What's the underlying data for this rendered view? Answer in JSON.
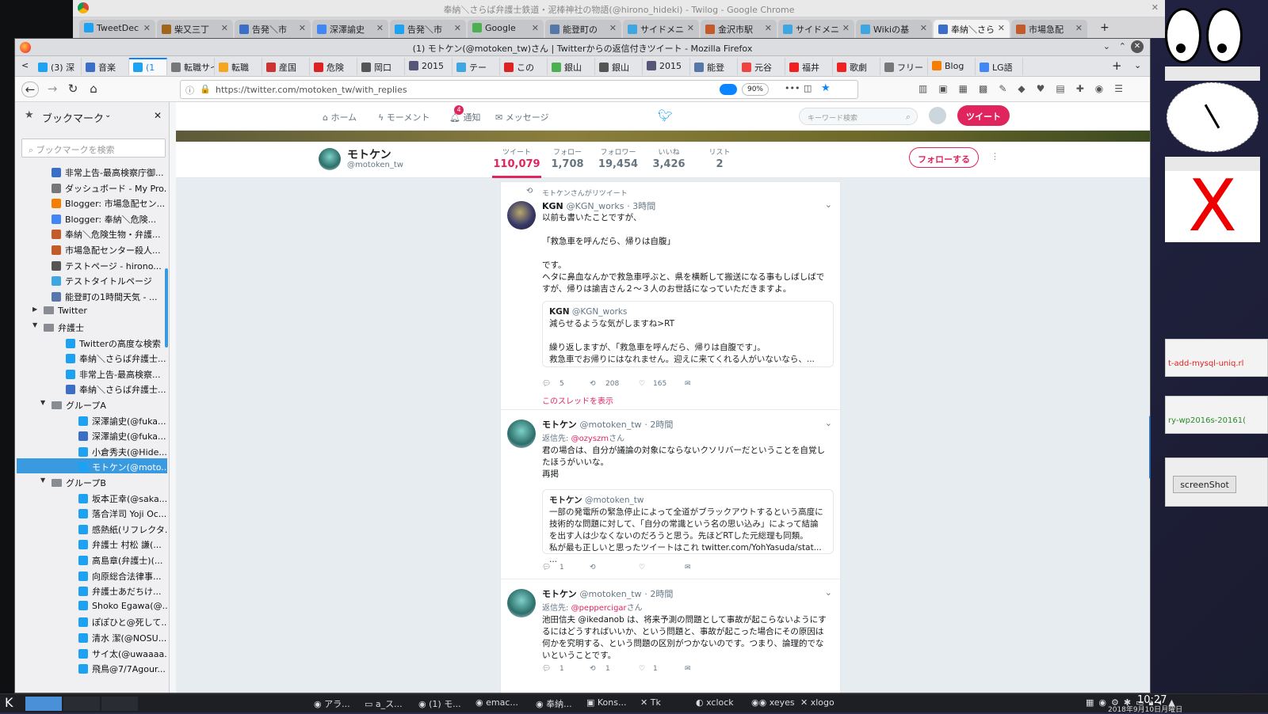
{
  "chrome": {
    "title": "奉納＼さらば弁護士鉄道・泥棒神社の物語(@hirono_hideki) - Twilog - Google Chrome",
    "tabs": [
      "TweetDec",
      "柴又三丁",
      "告発＼市",
      "深澤諭史",
      "告発＼市",
      "Google",
      "能登町の",
      "サイドメニ",
      "金沢市駅",
      "サイドメニ",
      "Wikiの基",
      "奉納＼さら",
      "市場急配"
    ]
  },
  "firefox": {
    "title": "(1) モトケン(@motoken_tw)さん | Twitterからの返信付きツイート - Mozilla Firefox",
    "tabs": [
      "(3) 深",
      "音楽",
      "(1",
      "転職サイ",
      "転職",
      "産国",
      "危険",
      "岡口",
      "2015",
      "テー",
      "この",
      "銀山",
      "銀山",
      "2015",
      "能登",
      "元谷",
      "福井",
      "歌劇",
      "フリー",
      "Blog",
      "LG語"
    ],
    "url": "https://twitter.com/motoken_tw/with_replies",
    "zoom": "90%"
  },
  "sidebar": {
    "title": "ブックマーク",
    "search_placeholder": "ブックマークを検索",
    "items": [
      {
        "label": "非常上告-最高検察庁御...",
        "c": "#3b6ec7",
        "lvl": 2
      },
      {
        "label": "ダッシュボード - My Pro...",
        "c": "#777",
        "lvl": 2
      },
      {
        "label": "Blogger: 市場急配セン...",
        "c": "#f57d00",
        "lvl": 2
      },
      {
        "label": "Blogger: 奉納＼危険...",
        "c": "#4285f4",
        "lvl": 2
      },
      {
        "label": "奉納＼危険生物・弁護...",
        "c": "#c35a2a",
        "lvl": 2
      },
      {
        "label": "市場急配センター殺人...",
        "c": "#c35a2a",
        "lvl": 2
      },
      {
        "label": "テストページ - hirono...",
        "c": "#555",
        "lvl": 2
      },
      {
        "label": "テストタイトルページ",
        "c": "#3ea6e0",
        "lvl": 2
      },
      {
        "label": "能登町の1時間天気 - ...",
        "c": "#5577aa",
        "lvl": 2
      },
      {
        "label": "Twitter",
        "c": "folder",
        "lvl": 1,
        "arrow": "▶"
      },
      {
        "label": "弁護士",
        "c": "folder",
        "lvl": 1,
        "arrow": "▼"
      },
      {
        "label": "Twitterの高度な検索",
        "c": "#1da1f2",
        "lvl": 3
      },
      {
        "label": "奉納＼さらば弁護士...",
        "c": "#1da1f2",
        "lvl": 3
      },
      {
        "label": "非常上告-最高検察...",
        "c": "#1da1f2",
        "lvl": 3
      },
      {
        "label": "奉納＼さらば弁護士...",
        "c": "#3b6ec7",
        "lvl": 3
      },
      {
        "label": "グループA",
        "c": "folder",
        "lvl": 2,
        "arrow": "▼"
      },
      {
        "label": "深澤諭史(@fuka...",
        "c": "#1da1f2",
        "lvl": 4
      },
      {
        "label": "深澤諭史(@fuka...",
        "c": "#3b6ec7",
        "lvl": 4
      },
      {
        "label": "小倉秀夫(@Hide...",
        "c": "#1da1f2",
        "lvl": 4
      },
      {
        "label": "モトケン(@moto...",
        "c": "#1da1f2",
        "lvl": 4,
        "sel": true
      },
      {
        "label": "グループB",
        "c": "folder",
        "lvl": 2,
        "arrow": "▼"
      },
      {
        "label": "坂本正幸(@saka...",
        "c": "#1da1f2",
        "lvl": 4
      },
      {
        "label": "落合洋司 Yoji Oc...",
        "c": "#1da1f2",
        "lvl": 4
      },
      {
        "label": "感熱紙(リフレクタ...",
        "c": "#1da1f2",
        "lvl": 4
      },
      {
        "label": "弁護士 村松 謙(...",
        "c": "#1da1f2",
        "lvl": 4
      },
      {
        "label": "高島章(弁護士)(...",
        "c": "#1da1f2",
        "lvl": 4
      },
      {
        "label": "向原総合法律事...",
        "c": "#1da1f2",
        "lvl": 4
      },
      {
        "label": "弁護士あだちけ...",
        "c": "#1da1f2",
        "lvl": 4
      },
      {
        "label": "Shoko Egawa(@...",
        "c": "#1da1f2",
        "lvl": 4
      },
      {
        "label": "ぽぽひと@死して...",
        "c": "#1da1f2",
        "lvl": 4
      },
      {
        "label": "清水 潔(@NOSU...",
        "c": "#1da1f2",
        "lvl": 4
      },
      {
        "label": "サイ太(@uwaaaa...",
        "c": "#1da1f2",
        "lvl": 4
      },
      {
        "label": "飛鳥@7/7Agour...",
        "c": "#1da1f2",
        "lvl": 4
      }
    ]
  },
  "twitter": {
    "nav": {
      "home": "ホーム",
      "moments": "モーメント",
      "notifications": "通知",
      "notif_count": "4",
      "messages": "メッセージ",
      "search_placeholder": "キーワード検索",
      "tweet_btn": "ツイート"
    },
    "profile": {
      "name": "モトケン",
      "handle": "@motoken_tw",
      "follow_btn": "フォローする",
      "stats": [
        {
          "label": "ツイート",
          "value": "110,079"
        },
        {
          "label": "フォロー",
          "value": "1,708"
        },
        {
          "label": "フォロワー",
          "value": "19,454"
        },
        {
          "label": "いいね",
          "value": "3,426"
        },
        {
          "label": "リスト",
          "value": "2"
        }
      ]
    },
    "tweets": [
      {
        "retweet_note": "モトケンさんがリツイート",
        "name": "KGN",
        "handle": "@KGN_works",
        "time": "· 3時間",
        "reply_to": "",
        "text": "以前も書いたことですが、\n\n「救急車を呼んだら、帰りは自腹」\n\nです。\nヘタに鼻血なんかで救急車呼ぶと、県を横断して搬送になる事もしばしばですが、帰りは諭吉さん２〜３人のお世話になっていただきますよ。",
        "quote_name": "KGN",
        "quote_handle": "@KGN_works",
        "quote_text": "減らせるような気がしますね>RT\n\n繰り返しますが、「救急車を呼んだら、帰りは自腹です」。\n救急車でお帰りにはなれません。迎えに来てくれる人がいないなら、...",
        "replies": "5",
        "retweets": "208",
        "likes": "165",
        "thread": "このスレッドを表示"
      },
      {
        "retweet_note": "",
        "name": "モトケン",
        "handle": "@motoken_tw",
        "time": "· 2時間",
        "reply_prefix": "返信先: ",
        "reply_to": "@ozyszm",
        "reply_suffix": "さん",
        "text": "君の場合は、自分が議論の対象にならないクソリバーだということを自覚したほうがいいな。\n再掲",
        "quote_name": "モトケン",
        "quote_handle": "@motoken_tw",
        "quote_text": "一部の発電所の緊急停止によって全道がブラックアウトするという高度に技術的な問題に対して、「自分の常識という名の思い込み」によって結論を出す人は少なくないのだろうと思う。先ほどRTした元総理も同類。\n私が最も正しいと思ったツイートはこれ twitter.com/YohYasuda/stat... ...",
        "replies": "1",
        "retweets": "",
        "likes": "",
        "thread": ""
      },
      {
        "retweet_note": "",
        "name": "モトケン",
        "handle": "@motoken_tw",
        "time": "· 2時間",
        "reply_prefix": "返信先: ",
        "reply_to": "@peppercigar",
        "reply_suffix": "さん",
        "text": "池田信夫 @ikedanob は、将来予測の問題として事故が起こらないようにするにはどうすればいいか、という問題と、事故が起こった場合にその原因は何かを究明する、という問題の区別がつかないのです。つまり、論理的でないということです。",
        "replies": "1",
        "retweets": "1",
        "likes": "1"
      }
    ]
  },
  "right": {
    "btn": "screenShot",
    "w1": "t-add-mysql-uniq.rl",
    "w2": "ry-wp2016s-20161("
  },
  "taskbar": {
    "items": [
      "アラ...",
      "a_ス...",
      "(1) モ...",
      "emac...",
      "奉納...",
      "Kons...",
      "Tk",
      "xclock",
      "xeyes",
      "xlogo"
    ],
    "time": "10:27",
    "date": "2018年9月10日月曜日"
  }
}
